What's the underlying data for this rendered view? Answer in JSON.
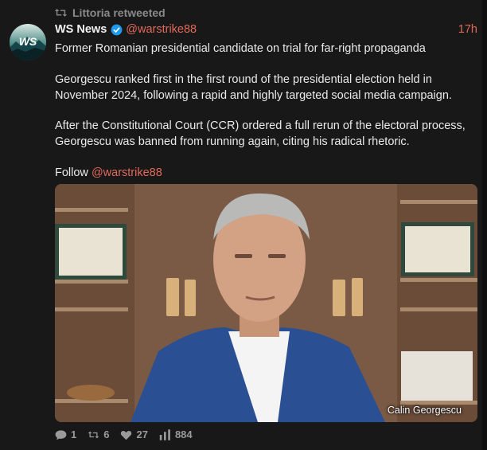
{
  "retweet": {
    "label": "Littoria retweeted",
    "icon": "retweet-icon"
  },
  "author": {
    "name": "WS News",
    "handle": "@warstrike88",
    "avatar_text": "WS",
    "verified_icon": "verified-badge-icon"
  },
  "time": "17h",
  "body": {
    "headline": "Former Romanian presidential candidate on trial for far-right propaganda",
    "paragraph1": "Georgescu ranked first in the first round of the presidential election held in November 2024, following a rapid and highly targeted social media campaign.",
    "paragraph2": "After the Constitutional Court (CCR) ordered a full rerun of the electoral process, Georgescu was banned from running again, citing his radical rhetoric.",
    "follow_prefix": "Follow ",
    "follow_handle": "@warstrike88"
  },
  "media": {
    "caption": "Calin Georgescu"
  },
  "stats": {
    "replies": "1",
    "retweets": "6",
    "likes": "27",
    "views": "884"
  },
  "colors": {
    "accent": "#e36a5a",
    "background": "#181818",
    "verified": "#1d9bf0",
    "muted": "#8a8a8a"
  }
}
